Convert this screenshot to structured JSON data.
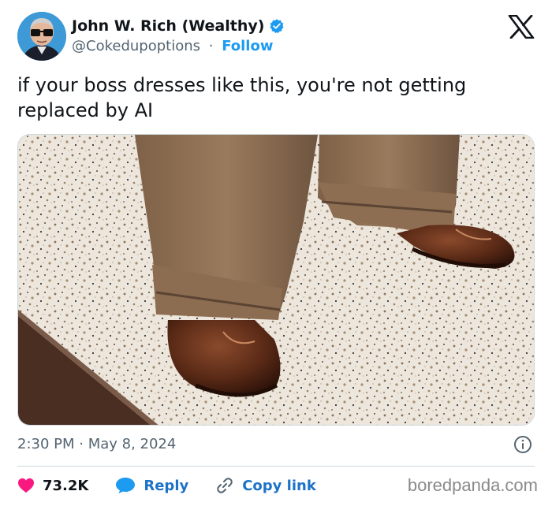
{
  "author": {
    "display_name": "John W. Rich (Wealthy)",
    "handle": "@Cokedupoptions",
    "separator": "·",
    "follow_label": "Follow"
  },
  "tweet": {
    "text": "if your boss dresses like this, you're not getting replaced by AI",
    "timestamp": "2:30 PM · May 8, 2024"
  },
  "actions": {
    "likes": "73.2K",
    "reply_label": "Reply",
    "copy_link_label": "Copy link"
  },
  "watermark": "boredpanda.com",
  "icons": {
    "verified": "verified-badge-icon",
    "x_logo": "x-logo-icon",
    "info": "info-icon",
    "like": "heart-icon",
    "reply": "speech-bubble-icon",
    "copy_link": "link-icon"
  },
  "colors": {
    "accent_blue": "#1d9bf0",
    "heart_pink": "#f91880",
    "muted_text": "#536471"
  }
}
